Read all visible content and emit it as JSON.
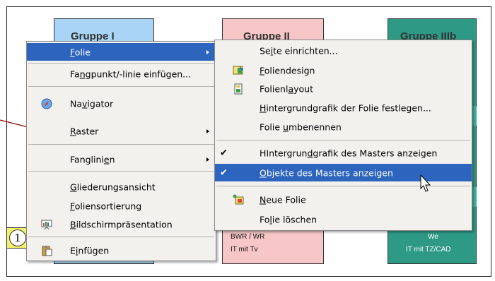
{
  "slide": {
    "groups": [
      {
        "title": "Gruppe I"
      },
      {
        "title": "Gruppe II",
        "line1": "BWR / WR",
        "line2": "IT mit Tv"
      },
      {
        "title": "Gruppe IIIb",
        "line1": "We",
        "line2": "IT mit TZ/CAD"
      }
    ],
    "badge": "1"
  },
  "context_menu": {
    "items": [
      {
        "label": "Folie",
        "underline": "F",
        "submenu": true,
        "highlighted": true
      },
      {
        "label": "Fangpunkt/-linie einfügen...",
        "underline": "n"
      },
      {
        "label": "Navigator",
        "underline": "v",
        "icon": "compass-icon"
      },
      {
        "label": "Raster",
        "underline": "R",
        "submenu": true
      },
      {
        "label": "Fanglinien",
        "underline": "e",
        "submenu": true
      },
      {
        "label": "Gliederungsansicht",
        "underline": "G"
      },
      {
        "label": "Foliensortierung",
        "underline": "F"
      },
      {
        "label": "Bildschirmpräsentation",
        "underline": "B",
        "icon": "presentation-icon"
      },
      {
        "label": "Einfügen",
        "underline": "i",
        "icon": "paste-icon"
      }
    ]
  },
  "submenu": {
    "items": [
      {
        "label": "Seite einrichten...",
        "underline": "i"
      },
      {
        "label": "Foliendesign",
        "underline": "F",
        "icon": "slide-design-icon"
      },
      {
        "label": "Folienlayout",
        "underline": "a",
        "icon": "slide-layout-icon"
      },
      {
        "label": "Hintergrundgrafik der Folie festlegen...",
        "underline": "H"
      },
      {
        "label": "Folie umbenennen",
        "underline": "u"
      },
      {
        "label": "HIntergrundgrafik des Masters anzeigen",
        "underline": "d",
        "checked": true
      },
      {
        "label": "Objekte des Masters anzeigen",
        "underline": "O",
        "checked": true,
        "highlighted": true
      },
      {
        "label": "Neue Folie",
        "underline": "N",
        "icon": "new-slide-icon"
      },
      {
        "label": "Folie löschen",
        "underline": "l"
      }
    ]
  },
  "colors": {
    "menu_bg": "#f2f1ee",
    "highlight": "#2d64bd",
    "group1": "#a9d4f5",
    "group2": "#f7c6c7",
    "group3": "#2e9a86",
    "annotation_arrow": "#8b0000"
  }
}
